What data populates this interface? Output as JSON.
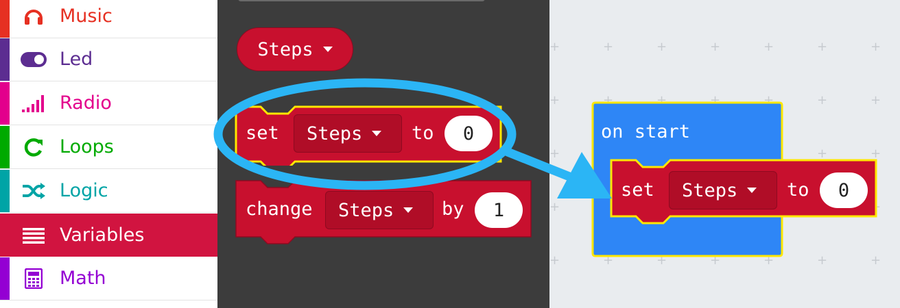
{
  "toolbox": {
    "categories": [
      {
        "label": "Music",
        "color": "#e63022",
        "icon": "headphones-icon"
      },
      {
        "label": "Led",
        "color": "#5c2d91",
        "icon": "toggle-icon"
      },
      {
        "label": "Radio",
        "color": "#e3008c",
        "icon": "signal-bars-icon"
      },
      {
        "label": "Loops",
        "color": "#00aa00",
        "icon": "refresh-icon"
      },
      {
        "label": "Logic",
        "color": "#00a4a6",
        "icon": "shuffle-icon"
      },
      {
        "label": "Variables",
        "color": "#dc143c",
        "icon": "list-icon",
        "selected": true
      },
      {
        "label": "Math",
        "color": "#9400d3",
        "icon": "calculator-icon"
      }
    ]
  },
  "flyout": {
    "variable_reporter": {
      "name": "Steps"
    },
    "set_block": {
      "keyword": "set",
      "variable": "Steps",
      "connector": "to",
      "value": "0"
    },
    "change_block": {
      "keyword": "change",
      "variable": "Steps",
      "connector": "by",
      "value": "1"
    }
  },
  "workspace": {
    "on_start": {
      "label": "on start",
      "color": "#1e90ff"
    },
    "set_block": {
      "keyword": "set",
      "variable": "Steps",
      "connector": "to",
      "value": "0"
    }
  },
  "annotation": {
    "circle_color": "#2bb5f5",
    "arrow_color": "#2bb5f5"
  }
}
